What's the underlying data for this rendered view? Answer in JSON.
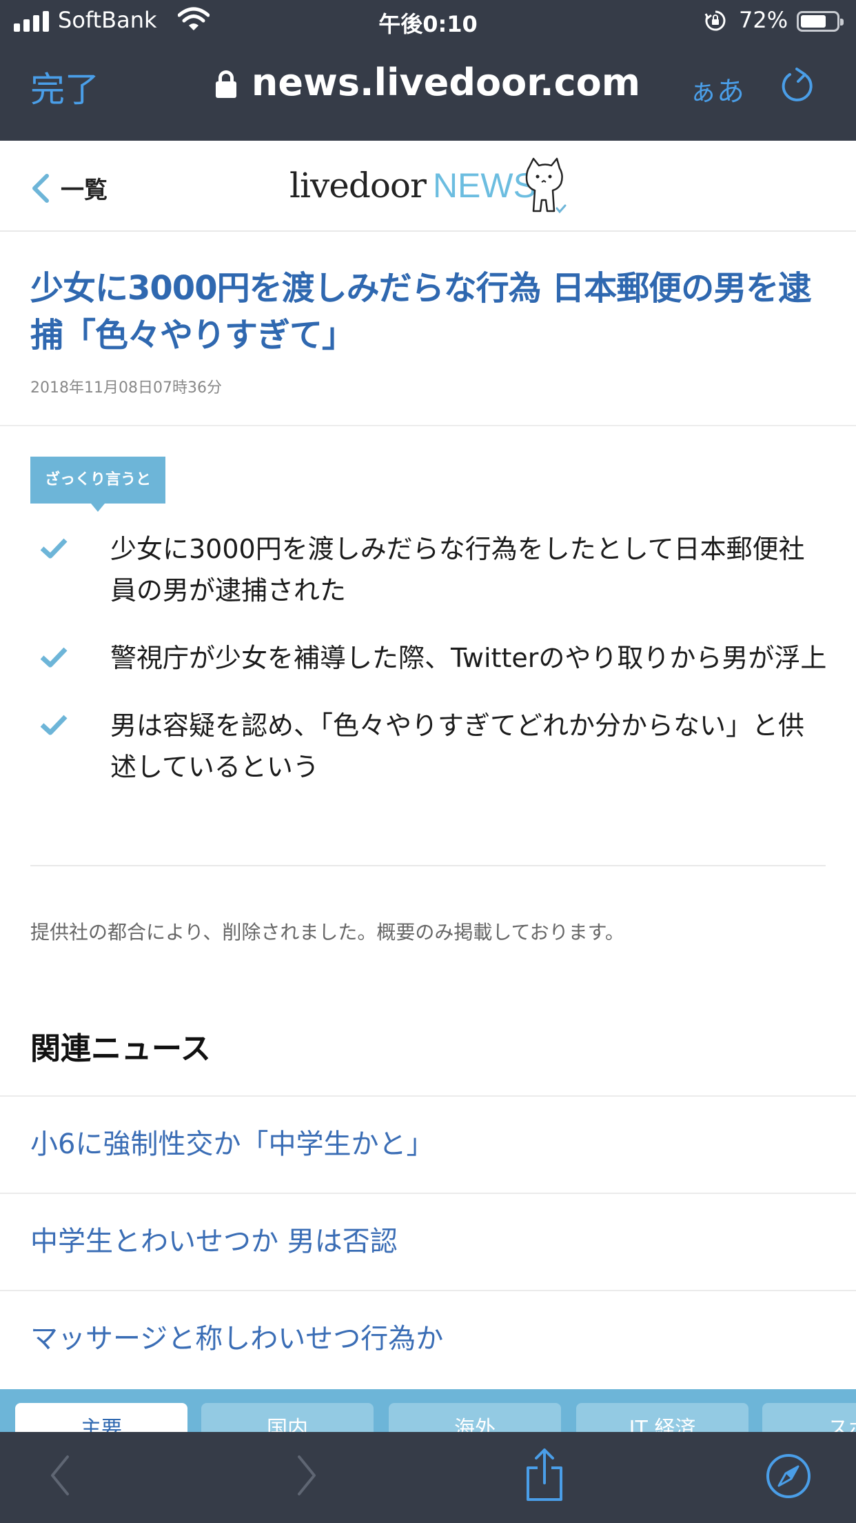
{
  "status_bar": {
    "carrier": "SoftBank",
    "time": "午後0:10",
    "battery_percent": "72%",
    "battery_level": 0.72
  },
  "browser": {
    "done_label": "完了",
    "url": "news.livedoor.com",
    "text_size_label": "ぁあ"
  },
  "site_header": {
    "back_label": "一覧",
    "logo_primary": "livedoor",
    "logo_secondary": "NEWS"
  },
  "article": {
    "headline": "少女に3000円を渡しみだらな行為 日本郵便の男を逮捕「色々やりすぎて」",
    "published": "2018年11月08日07時36分",
    "summary_label": "ざっくり言うと",
    "summary_points": [
      "少女に3000円を渡しみだらな行為をしたとして日本郵便社員の男が逮捕された",
      "警視庁が少女を補導した際、Twitterのやり取りから男が浮上",
      "男は容疑を認め、「色々やりすぎてどれか分からない」と供述しているという"
    ],
    "notice": "提供社の都合により、削除されました。概要のみ掲載しております。"
  },
  "related": {
    "heading": "関連ニュース",
    "items": [
      "小6に強制性交か「中学生かと」",
      "中学生とわいせつか 男は否認",
      "マッサージと称しわいせつ行為か"
    ]
  },
  "category_tabs": [
    "主要",
    "国内",
    "海外",
    "IT 経済",
    "スポ"
  ],
  "colors": {
    "chrome": "#363c48",
    "ios_blue": "#4a9ee8",
    "headline_blue": "#2f68b0",
    "accent_teal": "#6db5d8",
    "link_blue": "#3a6db5"
  },
  "icons": [
    "signal-icon",
    "wifi-icon",
    "rotation-lock-icon",
    "battery-icon",
    "padlock-icon",
    "reload-icon",
    "chevron-left-icon",
    "cat-mascot-icon",
    "checkmark-icon",
    "back-arrow-icon",
    "forward-arrow-icon",
    "share-icon",
    "compass-icon"
  ]
}
